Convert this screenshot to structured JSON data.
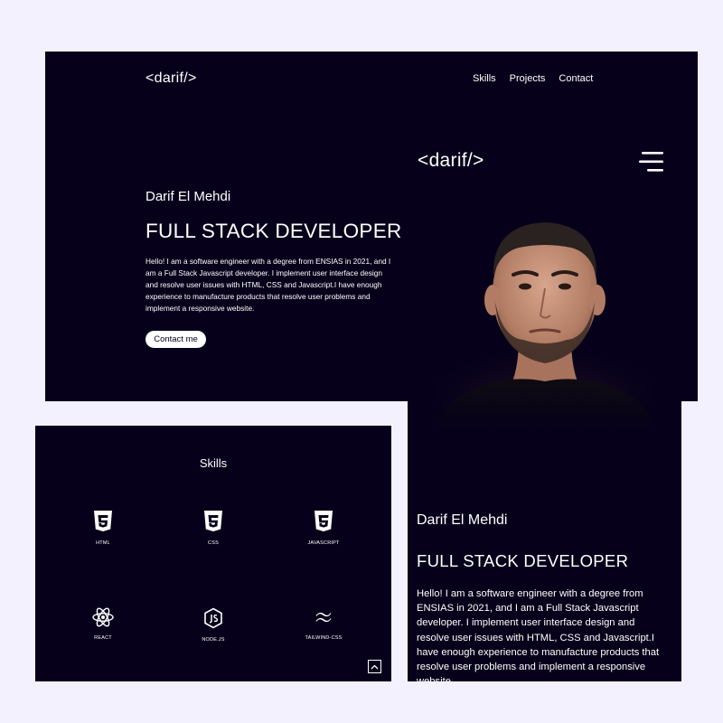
{
  "desktop": {
    "logo": "<darif/>",
    "nav": [
      "Skills",
      "Projects",
      "Contact"
    ],
    "hero": {
      "name": "Darif El Mehdi",
      "role": "FULL STACK DEVELOPER",
      "description": "Hello! I am a software engineer with a degree from ENSIAS in 2021, and I am a Full Stack Javascript developer. I implement user interface design and resolve user issues with HTML, CSS and Javascript.I have enough experience to manufacture products that resolve user problems and implement a responsive website.",
      "cta": "Contact me"
    }
  },
  "skills": {
    "title": "Skills",
    "items": [
      {
        "label": "HTML",
        "icon": "html5-icon"
      },
      {
        "label": "CSS",
        "icon": "css3-icon"
      },
      {
        "label": "JAVASCRIPT",
        "icon": "javascript-icon"
      },
      {
        "label": "REACT",
        "icon": "react-icon"
      },
      {
        "label": "NODE.JS",
        "icon": "nodejs-icon"
      },
      {
        "label": "TAILWIND-CSS",
        "icon": "tailwind-icon"
      }
    ]
  },
  "mobile": {
    "logo": "<darif/>",
    "hero": {
      "name": "Darif El Mehdi",
      "role": "FULL STACK DEVELOPER",
      "description": "Hello! I am a software engineer with a degree from ENSIAS in 2021, and I am a Full Stack Javascript developer. I implement user interface design and resolve user issues with HTML, CSS and Javascript.I have enough experience to manufacture products that resolve user problems and implement a responsive website."
    }
  },
  "colors": {
    "page_background": "#f3f1fd",
    "panel_background": "#07001a",
    "text": "#ffffff"
  }
}
